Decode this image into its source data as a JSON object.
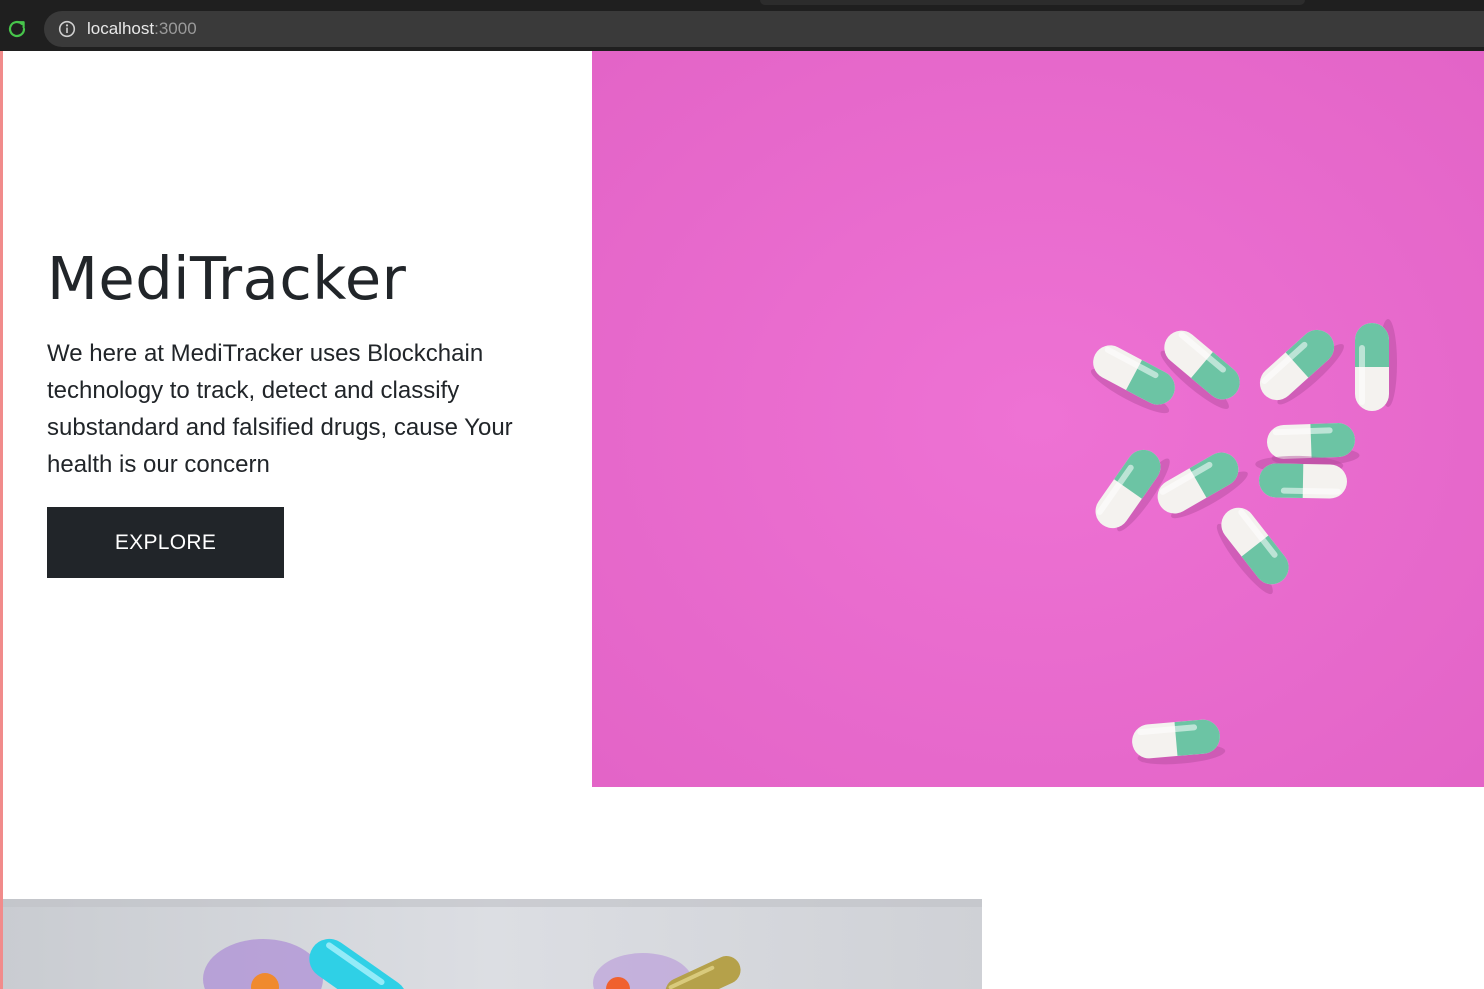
{
  "browser": {
    "url_host": "localhost",
    "url_port": ":3000",
    "icons": [
      "reload-icon",
      "site-info-icon"
    ]
  },
  "hero": {
    "title": "MediTracker",
    "description": "We here at MediTracker uses Blockchain technology to track, detect and classify substandard and falsified drugs, cause Your health is our concern",
    "button_label": "EXPLORE"
  },
  "colors": {
    "hero_image_background": "#ec6fd1",
    "capsule_teal": "#6cc4a4",
    "capsule_white": "#f4f2ef",
    "button_background": "#212529",
    "left_accent": "#f18b8b",
    "text": "#212529"
  }
}
